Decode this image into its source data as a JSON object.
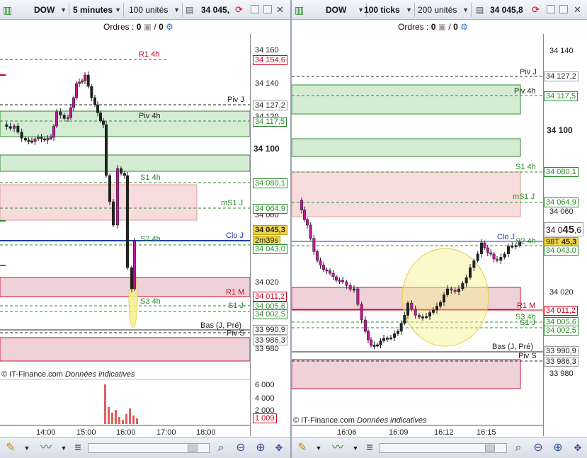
{
  "left": {
    "toolbar": {
      "instrument": "DOW",
      "timeframe": "5 minutes",
      "units": "100 unités",
      "price": "34 045,"
    },
    "orders": {
      "label": "Ordres :",
      "count_a": "0",
      "sep": "/",
      "count_b": "0"
    },
    "levels": {
      "r1_4h": "R1 4h",
      "piv_j": "Piv J",
      "piv_4h": "Piv 4h",
      "s1_4h": "S1 4h",
      "ms1_j": "mS1 J",
      "clo_j": "Clo J",
      "s2_4h": "S2 4h",
      "r1_m": "R1 M",
      "s3_4h": "S3 4h",
      "s1_j": "S1 J",
      "bas": "Bas (J, Pré)",
      "piv_s": "Piv S"
    },
    "scale_ticks": [
      "34 160",
      "34 140",
      "34 120",
      "34 100",
      "34 060",
      "34 020",
      "33 980"
    ],
    "tags": {
      "r1_4h": "34 154,6",
      "piv_j": "34 127,2",
      "piv_4h": "34 117,5",
      "s1_4h": "34 080,1",
      "ms1_j": "34 064,9",
      "price": "34 045,3",
      "timer": "2m39s",
      "s2_4h": "34 043,0",
      "r1_m": "34 011,2",
      "s1_j": "34 005,6",
      "s3_4h": "34 002,5",
      "bas": "33 990,9",
      "piv_s": "33 986,3"
    },
    "footer_source": "© IT-Finance.com",
    "footer_note": "Données indicatives",
    "volume_ticks": [
      "6 000",
      "4 000",
      "2 000"
    ],
    "volume_tag": "1 009",
    "time_ticks": [
      "14:00",
      "15:00",
      "16:00",
      "17:00",
      "18:00"
    ]
  },
  "right": {
    "toolbar": {
      "instrument": "DOW",
      "timeframe": "100 ticks",
      "units": "200 unités",
      "price": "34 045,8"
    },
    "orders": {
      "label": "Ordres :",
      "count_a": "0",
      "sep": "/",
      "count_b": "0"
    },
    "levels": {
      "piv_j": "Piv J",
      "piv_4h": "Piv 4h",
      "s1_4h": "S1 4h",
      "ms1_j": "mS1 J",
      "clo_j": "Clo J",
      "s2_4h": "S2 4h",
      "r1_m": "R1 M",
      "s3_4h": "S3 4h",
      "s1_j": "S1 J",
      "bas": "Bas (J, Pré)",
      "piv_s": "Piv S"
    },
    "scale_ticks": [
      "34 140",
      "34 100",
      "34 060",
      "34 020",
      "33 980"
    ],
    "tags": {
      "piv_j": "34 127,2",
      "piv_4h": "34 117,5",
      "s1_4h": "34 080,1",
      "ms1_j": "34 064,9",
      "price_prefix": "34 0",
      "price_big": "45",
      "price_suffix": ",6",
      "ticks_left": "98T",
      "price_small": "45,3",
      "s2_4h": "34 043,0",
      "r1_m": "34 011,2",
      "s1_j": "34 005,6",
      "s3_4h": "34 002,5",
      "bas": "33 990,9",
      "piv_s": "33 986,3"
    },
    "footer_source": "© IT-Finance.com",
    "footer_note": "Données indicatives",
    "time_ticks": [
      "16:06",
      "16:09",
      "16:12",
      "16:15"
    ]
  },
  "colors": {
    "level_red": "#d0021b",
    "level_green": "#2a8a2a",
    "level_blue": "#1f3fa6",
    "zone_green": "#d4ecd4",
    "zone_red": "#f3d6d6",
    "candle_up": "#222222",
    "candle_down": "#c8139a",
    "highlight": "#f7f08a"
  }
}
